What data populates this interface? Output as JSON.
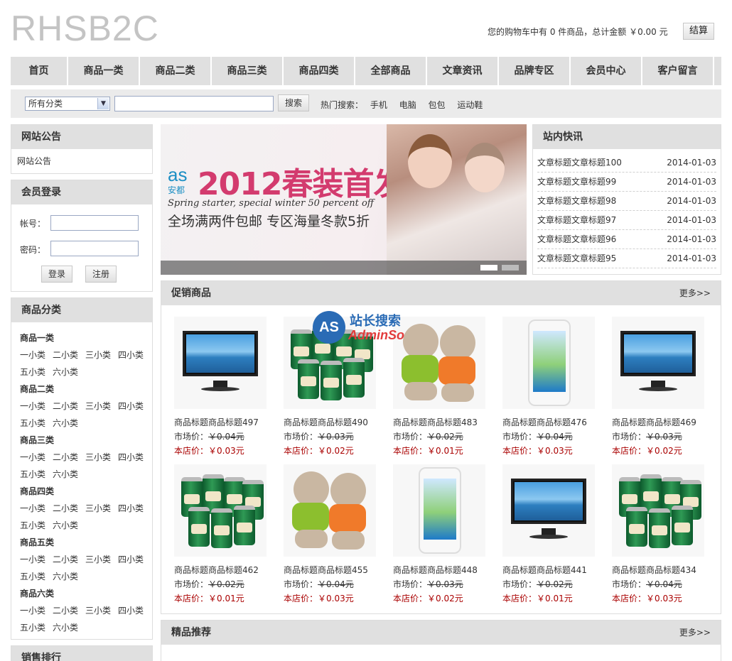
{
  "header": {
    "logo": "RHSB2C",
    "cart_text": "您的购物车中有 0 件商品，总计金额 ￥0.00 元",
    "checkout_label": "结算"
  },
  "nav": [
    "首页",
    "商品一类",
    "商品二类",
    "商品三类",
    "商品四类",
    "全部商品",
    "文章资讯",
    "品牌专区",
    "会员中心",
    "客户留言"
  ],
  "search": {
    "category_selected": "所有分类",
    "query_value": "",
    "button_label": "搜索",
    "hot_label": "热门搜索：",
    "hot_terms": [
      "手机",
      "电脑",
      "包包",
      "运动鞋"
    ]
  },
  "notice": {
    "title": "网站公告",
    "body": "网站公告"
  },
  "login": {
    "title": "会员登录",
    "account_label": "帐号：",
    "password_label": "密码：",
    "login_button": "登录",
    "register_button": "注册"
  },
  "categories": {
    "title": "商品分类",
    "groups": [
      {
        "name": "商品一类",
        "subs": [
          "一小类",
          "二小类",
          "三小类",
          "四小类",
          "五小类",
          "六小类"
        ]
      },
      {
        "name": "商品二类",
        "subs": [
          "一小类",
          "二小类",
          "三小类",
          "四小类",
          "五小类",
          "六小类"
        ]
      },
      {
        "name": "商品三类",
        "subs": [
          "一小类",
          "二小类",
          "三小类",
          "四小类",
          "五小类",
          "六小类"
        ]
      },
      {
        "name": "商品四类",
        "subs": [
          "一小类",
          "二小类",
          "三小类",
          "四小类",
          "五小类",
          "六小类"
        ]
      },
      {
        "name": "商品五类",
        "subs": [
          "一小类",
          "二小类",
          "三小类",
          "四小类",
          "五小类",
          "六小类"
        ]
      },
      {
        "name": "商品六类",
        "subs": [
          "一小类",
          "二小类",
          "三小类",
          "四小类",
          "五小类",
          "六小类"
        ]
      }
    ]
  },
  "sales_rank": {
    "title": "销售排行"
  },
  "banner": {
    "brand": "as",
    "brand_cn": "安都",
    "headline": "2012春装首发",
    "tagline_en": "Spring starter, special winter 50 percent off",
    "tagline_cn": "全场满两件包邮  专区海量冬款5折"
  },
  "news": {
    "title": "站内快讯",
    "items": [
      {
        "title": "文章标题文章标题100",
        "date": "2014-01-03"
      },
      {
        "title": "文章标题文章标题99",
        "date": "2014-01-03"
      },
      {
        "title": "文章标题文章标题98",
        "date": "2014-01-03"
      },
      {
        "title": "文章标题文章标题97",
        "date": "2014-01-03"
      },
      {
        "title": "文章标题文章标题96",
        "date": "2014-01-03"
      },
      {
        "title": "文章标题文章标题95",
        "date": "2014-01-03"
      }
    ]
  },
  "promo": {
    "title": "促销商品",
    "more": "更多>>",
    "products": [
      {
        "name": "商品标题商品标题497",
        "market_label": "市场价：",
        "market": "￥0.04元",
        "price_label": "本店价：",
        "price": "￥0.03元",
        "kind": "tv"
      },
      {
        "name": "商品标题商品标题490",
        "market_label": "市场价：",
        "market": "￥0.03元",
        "price_label": "本店价：",
        "price": "￥0.02元",
        "kind": "cans"
      },
      {
        "name": "商品标题商品标题483",
        "market_label": "市场价：",
        "market": "￥0.02元",
        "price_label": "本店价：",
        "price": "￥0.01元",
        "kind": "bears"
      },
      {
        "name": "商品标题商品标题476",
        "market_label": "市场价：",
        "market": "￥0.04元",
        "price_label": "本店价：",
        "price": "￥0.03元",
        "kind": "phone"
      },
      {
        "name": "商品标题商品标题469",
        "market_label": "市场价：",
        "market": "￥0.03元",
        "price_label": "本店价：",
        "price": "￥0.02元",
        "kind": "tv"
      },
      {
        "name": "商品标题商品标题462",
        "market_label": "市场价：",
        "market": "￥0.02元",
        "price_label": "本店价：",
        "price": "￥0.01元",
        "kind": "cans"
      },
      {
        "name": "商品标题商品标题455",
        "market_label": "市场价：",
        "market": "￥0.04元",
        "price_label": "本店价：",
        "price": "￥0.03元",
        "kind": "bears"
      },
      {
        "name": "商品标题商品标题448",
        "market_label": "市场价：",
        "market": "￥0.03元",
        "price_label": "本店价：",
        "price": "￥0.02元",
        "kind": "phone"
      },
      {
        "name": "商品标题商品标题441",
        "market_label": "市场价：",
        "market": "￥0.02元",
        "price_label": "本店价：",
        "price": "￥0.01元",
        "kind": "tv"
      },
      {
        "name": "商品标题商品标题434",
        "market_label": "市场价：",
        "market": "￥0.04元",
        "price_label": "本店价：",
        "price": "￥0.03元",
        "kind": "cans"
      }
    ]
  },
  "featured": {
    "title": "精品推荐",
    "more": "更多>>"
  },
  "watermark": {
    "mark": "AS",
    "cn": "站长搜索",
    "en": "AdminSo"
  }
}
